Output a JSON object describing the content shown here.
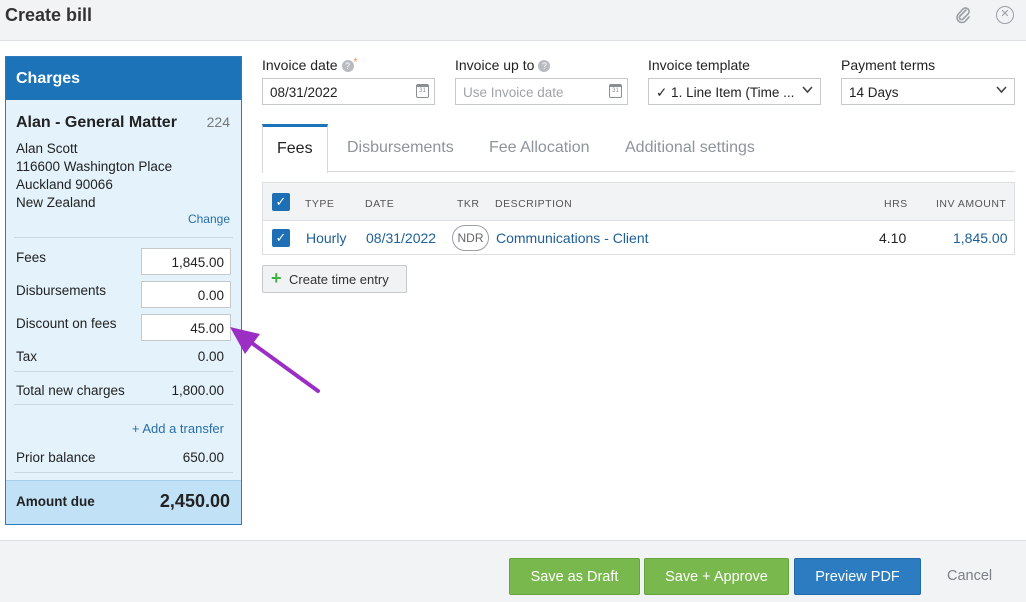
{
  "header": {
    "title": "Create bill",
    "attach_icon": "paperclip-icon",
    "close_icon": "close-icon"
  },
  "charges": {
    "heading": "Charges",
    "matter_name": "Alan - General Matter",
    "matter_number": "224",
    "address": [
      "Alan Scott",
      "116600 Washington Place",
      "Auckland 90066",
      "New Zealand"
    ],
    "change_link": "Change",
    "fees_label": "Fees",
    "fees_value": "1,845.00",
    "disbursements_label": "Disbursements",
    "disbursements_value": "0.00",
    "discount_label": "Discount on fees",
    "discount_value": "45.00",
    "tax_label": "Tax",
    "tax_value": "0.00",
    "total_label": "Total new charges",
    "total_value": "1,800.00",
    "add_transfer": "+ Add a transfer",
    "prior_label": "Prior balance",
    "prior_value": "650.00",
    "amount_due_label": "Amount due",
    "amount_due_value": "2,450.00"
  },
  "form": {
    "invoice_date_label": "Invoice date",
    "invoice_date_value": "08/31/2022",
    "required_mark": "*",
    "invoice_up_to_label": "Invoice up to",
    "invoice_up_to_placeholder": "Use Invoice date",
    "template_label": "Invoice template",
    "template_value": "✓ 1. Line Item (Time ...",
    "terms_label": "Payment terms",
    "terms_value": "14 Days",
    "help_glyph": "?",
    "calendar_glyph": "31"
  },
  "tabs": [
    "Fees",
    "Disbursements",
    "Fee Allocation",
    "Additional settings"
  ],
  "table": {
    "headers": {
      "type": "TYPE",
      "date": "DATE",
      "tkr": "TKR",
      "description": "DESCRIPTION",
      "hrs": "HRS",
      "amount": "INV AMOUNT"
    },
    "row": {
      "type": "Hourly",
      "date": "08/31/2022",
      "tkr": "NDR",
      "description": "Communications - Client",
      "hrs": "4.10",
      "amount": "1,845.00"
    }
  },
  "create_time_entry": "Create time entry",
  "footer": {
    "save_draft": "Save as Draft",
    "save_approve": "Save + Approve",
    "preview": "Preview PDF",
    "cancel": "Cancel"
  },
  "colors": {
    "accent": "#1d73b8",
    "green": "#78b84c",
    "arrow": "#9b2fc4"
  }
}
